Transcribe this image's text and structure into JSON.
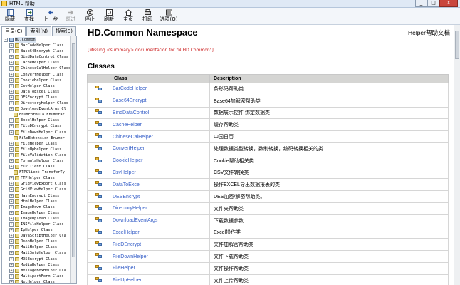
{
  "window": {
    "title": "HTML 帮助",
    "buttons": [
      "_",
      "□",
      "X"
    ]
  },
  "toolbar": {
    "items": [
      {
        "label": "隐藏",
        "icon": "hide-icon",
        "enabled": true
      },
      {
        "label": "查找",
        "icon": "locate-icon",
        "enabled": true
      },
      {
        "label": "上一步",
        "icon": "back-arrow-icon",
        "enabled": true
      },
      {
        "label": "前进",
        "icon": "forward-arrow-icon",
        "enabled": false
      },
      {
        "label": "停止",
        "icon": "stop-icon",
        "enabled": true
      },
      {
        "label": "刷新",
        "icon": "refresh-icon",
        "enabled": true
      },
      {
        "label": "主页",
        "icon": "home-icon",
        "enabled": true
      },
      {
        "label": "打印",
        "icon": "print-icon",
        "enabled": true
      },
      {
        "label": "选项(O)",
        "icon": "options-icon",
        "enabled": true
      }
    ]
  },
  "sidebar": {
    "tabs": [
      {
        "label": "目录(C)",
        "active": true
      },
      {
        "label": "索引(N)",
        "active": false
      },
      {
        "label": "搜索(S)",
        "active": false
      }
    ],
    "root": "HD.Common",
    "items": [
      {
        "label": "BarCodeHelper Class",
        "expandable": true
      },
      {
        "label": "Base64Encrypt Class",
        "expandable": true
      },
      {
        "label": "BindDataControl Class",
        "expandable": true
      },
      {
        "label": "CacheHelper Class",
        "expandable": true
      },
      {
        "label": "ChineseCalHelper Class",
        "expandable": true
      },
      {
        "label": "ConvertHelper Class",
        "expandable": true
      },
      {
        "label": "CookieHelper Class",
        "expandable": true
      },
      {
        "label": "CsvHelper Class",
        "expandable": true
      },
      {
        "label": "DataToExcel Class",
        "expandable": true
      },
      {
        "label": "DESEncrypt Class",
        "expandable": true
      },
      {
        "label": "DirectoryHelper Class",
        "expandable": true
      },
      {
        "label": "DownloadEventArgs Cl",
        "expandable": true
      },
      {
        "label": "EnumFormula Enumerat",
        "expandable": false
      },
      {
        "label": "ExcelHelper Class",
        "expandable": true
      },
      {
        "label": "FileDEncrypt Class",
        "expandable": true
      },
      {
        "label": "FileDownHelper Class",
        "expandable": true
      },
      {
        "label": "FileExtension Enumer",
        "expandable": false
      },
      {
        "label": "FileHelper Class",
        "expandable": true
      },
      {
        "label": "FileUpHelper Class",
        "expandable": true
      },
      {
        "label": "FileValidation Class",
        "expandable": true
      },
      {
        "label": "FormulaHelper Class",
        "expandable": true
      },
      {
        "label": "FTPClient Class",
        "expandable": true
      },
      {
        "label": "FTPClient.TransferTy",
        "expandable": false
      },
      {
        "label": "FTPHelper Class",
        "expandable": true
      },
      {
        "label": "GridViewExport Class",
        "expandable": true
      },
      {
        "label": "GridViewHelper Class",
        "expandable": true
      },
      {
        "label": "HashEncrypt Class",
        "expandable": true
      },
      {
        "label": "HtmlHelper Class",
        "expandable": true
      },
      {
        "label": "ImageDown Class",
        "expandable": true
      },
      {
        "label": "ImageHelper Class",
        "expandable": true
      },
      {
        "label": "ImageUpload Class",
        "expandable": true
      },
      {
        "label": "INIFileHelper Class",
        "expandable": true
      },
      {
        "label": "IpHelper Class",
        "expandable": true
      },
      {
        "label": "JavaScriptHelper Cla",
        "expandable": true
      },
      {
        "label": "JsonHelper Class",
        "expandable": true
      },
      {
        "label": "MailHelper Class",
        "expandable": true
      },
      {
        "label": "MailSmtpHelper Class",
        "expandable": true
      },
      {
        "label": "MD5Encrypt Class",
        "expandable": true
      },
      {
        "label": "MediaHelper Class",
        "expandable": true
      },
      {
        "label": "MessageBoxHelper Cla",
        "expandable": true
      },
      {
        "label": "MultipartForm Class",
        "expandable": true
      },
      {
        "label": "NetHelper Class",
        "expandable": true
      }
    ]
  },
  "main": {
    "title": "HD.Common Namespace",
    "doc_label": "Helper帮助文档",
    "missing_note": "[Missing <summary> documentation for \"N:HD.Common\"]",
    "section_title": "Classes",
    "table": {
      "headers": [
        "",
        "Class",
        "Description"
      ],
      "rows": [
        {
          "name": "BarCodeHelper",
          "desc": "条形码帮助类"
        },
        {
          "name": "Base64Encrypt",
          "desc": "Base64加解密帮助类"
        },
        {
          "name": "BindDataControl",
          "desc": "数据展示控件 绑定数据类"
        },
        {
          "name": "CacheHelper",
          "desc": "缓存帮助类"
        },
        {
          "name": "ChineseCalHelper",
          "desc": "中国日历"
        },
        {
          "name": "ConvertHelper",
          "desc": "处理数据类型转换，数制转换，编码转换相关的类"
        },
        {
          "name": "CookieHelper",
          "desc": "Cookie帮助相关类"
        },
        {
          "name": "CsvHelper",
          "desc": "CSV文件转换类"
        },
        {
          "name": "DataToExcel",
          "desc": "操作EXCEL导出数据报表的类"
        },
        {
          "name": "DESEncrypt",
          "desc": "DES加密/解密帮助类。"
        },
        {
          "name": "DirectoryHelper",
          "desc": "文件夹帮助类"
        },
        {
          "name": "DownloadEventArgs",
          "desc": "下载数据参数"
        },
        {
          "name": "ExcelHelper",
          "desc": "Excel操作类"
        },
        {
          "name": "FileDEncrypt",
          "desc": "文件加解密帮助类"
        },
        {
          "name": "FileDownHelper",
          "desc": "文件下载帮助类"
        },
        {
          "name": "FileHelper",
          "desc": "文件操作帮助类"
        },
        {
          "name": "FileUpHelper",
          "desc": "文件上传帮助类"
        }
      ]
    }
  },
  "colors": {
    "link": "#3a62c9",
    "missing": "#cc2222",
    "header_bg": "#d5d5d3",
    "titlebar_bg": "#dfe9f5"
  }
}
